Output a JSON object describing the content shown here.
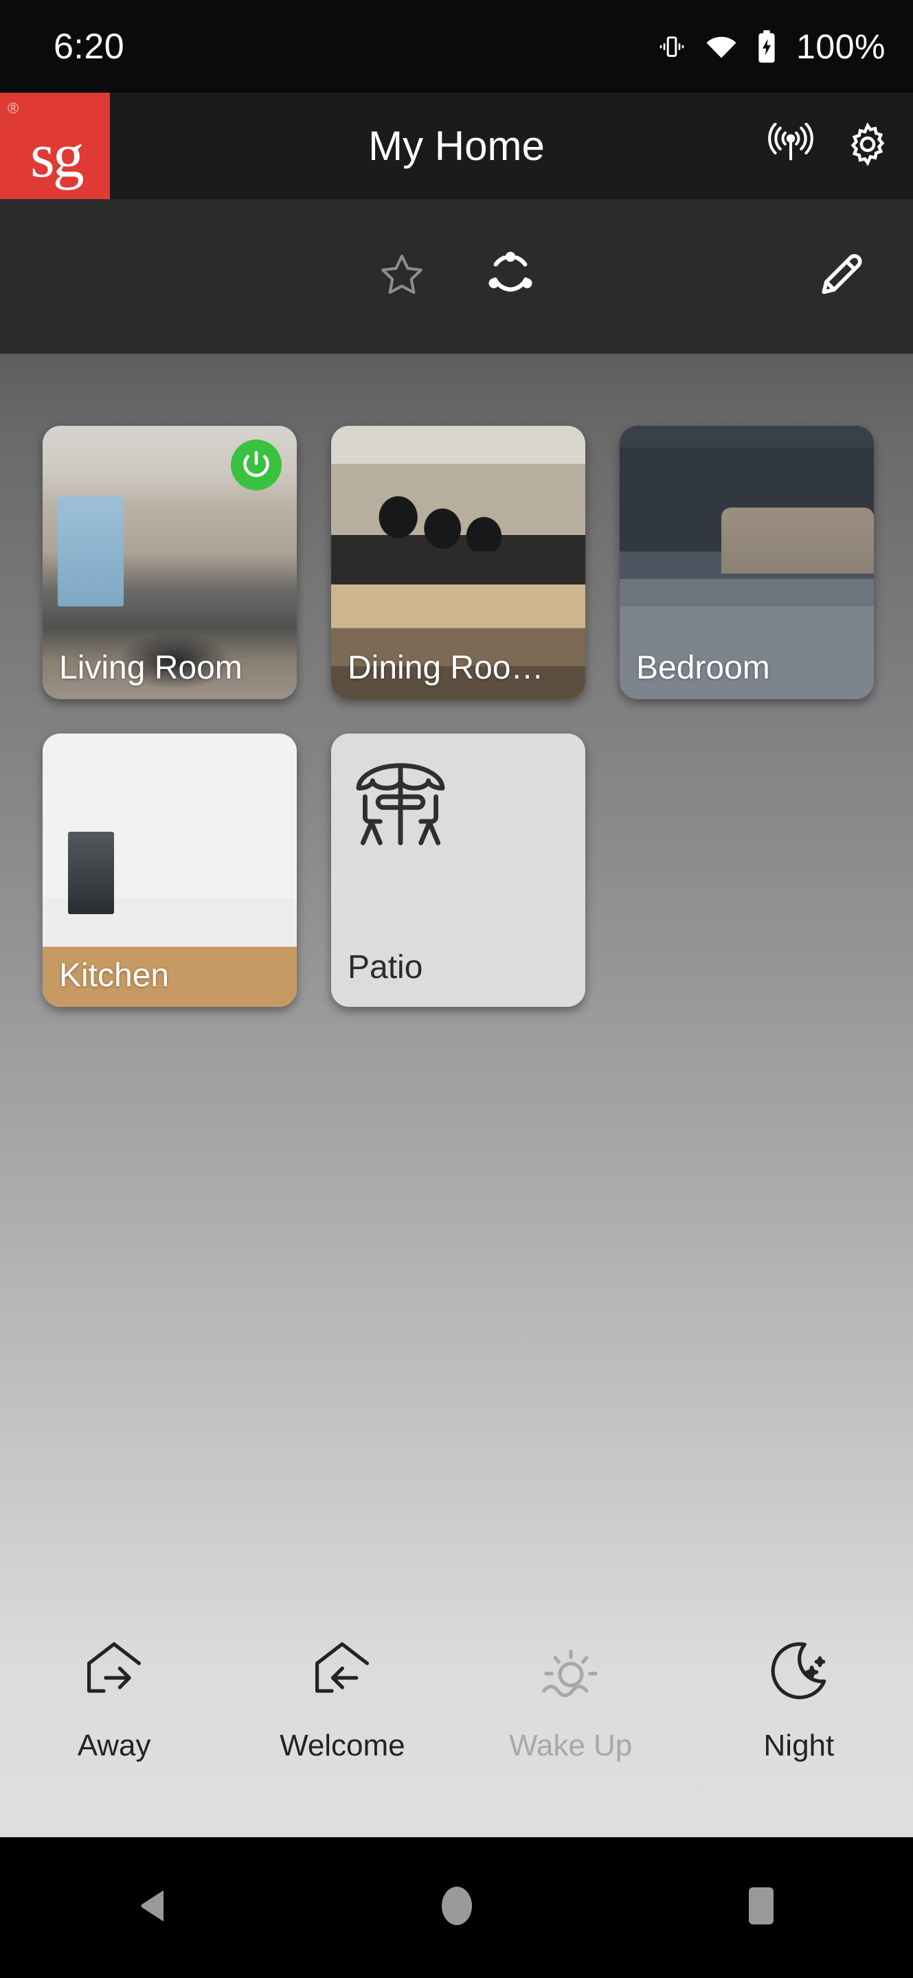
{
  "status_bar": {
    "clock": "6:20",
    "battery_percent": "100%",
    "icons": [
      "vibrate-icon",
      "wifi-icon",
      "battery-charging-icon"
    ]
  },
  "app_bar": {
    "brand": {
      "text": "sg",
      "registered_mark": "®",
      "color": "#e03a35"
    },
    "title": "My Home",
    "actions": [
      {
        "name": "broadcast-icon",
        "label": "Broadcast"
      },
      {
        "name": "gear-icon",
        "label": "Settings"
      }
    ]
  },
  "sub_toolbar": {
    "tabs": [
      {
        "name": "favorites-tab",
        "icon": "star-icon",
        "label": "Favorites",
        "active": false
      },
      {
        "name": "rooms-tab",
        "icon": "rooms-circle-icon",
        "label": "Rooms",
        "active": true
      }
    ],
    "edit": {
      "icon": "pencil-icon",
      "label": "Edit"
    }
  },
  "rooms": [
    {
      "label": "Living Room",
      "type": "photo",
      "photo": "ph-living",
      "power_on": true
    },
    {
      "label": "Dining Roo…",
      "type": "photo",
      "photo": "ph-dining",
      "power_on": false
    },
    {
      "label": "Bedroom",
      "type": "photo",
      "photo": "ph-bedroom",
      "power_on": false
    },
    {
      "label": "Kitchen",
      "type": "photo",
      "photo": "ph-kitchen",
      "power_on": false
    },
    {
      "label": "Patio",
      "type": "icon",
      "icon": "patio-umbrella-icon",
      "power_on": false
    }
  ],
  "scenes": [
    {
      "label": "Away",
      "icon": "house-arrow-right-icon",
      "enabled": true
    },
    {
      "label": "Welcome",
      "icon": "house-arrow-left-icon",
      "enabled": true
    },
    {
      "label": "Wake Up",
      "icon": "sunrise-icon",
      "enabled": false
    },
    {
      "label": "Night",
      "icon": "moon-stars-icon",
      "enabled": true
    }
  ],
  "nav_bar": {
    "buttons": [
      {
        "name": "back-button",
        "icon": "triangle-left-icon"
      },
      {
        "name": "home-button",
        "icon": "circle-icon"
      },
      {
        "name": "recents-button",
        "icon": "square-icon"
      }
    ]
  },
  "colors": {
    "brand_red": "#e03a35",
    "power_on_green": "#39c23f",
    "status_bar_bg": "#0b0b0b",
    "app_bar_bg": "#1b1b1b",
    "toolbar_bg": "#2b2b2b"
  }
}
